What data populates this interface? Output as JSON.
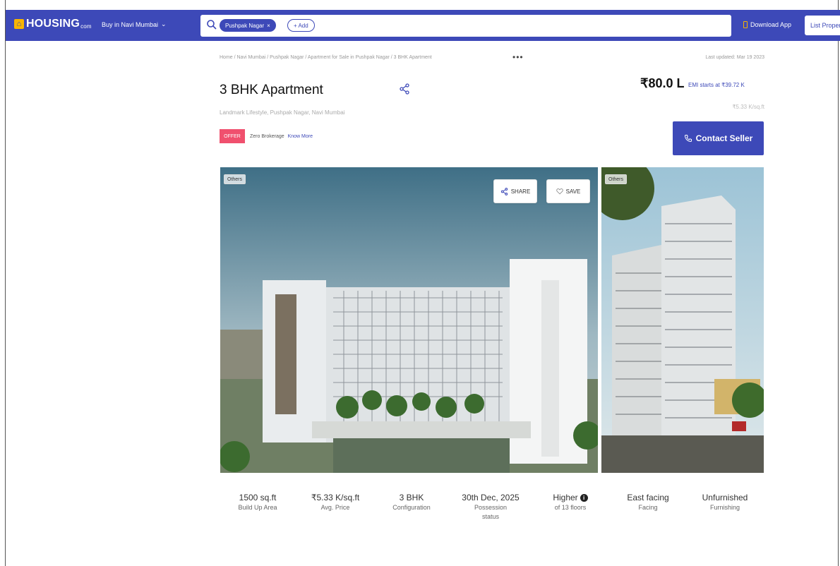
{
  "header": {
    "logo_text": "HOUSING",
    "logo_suffix": "com",
    "city_select": "Buy in Navi Mumbai",
    "search_chip": "Pushpak Nagar",
    "add_chip": "+ Add",
    "download_app": "Download App",
    "list_property": "List Property",
    "brand_color": "#3d49b8",
    "accent_color": "#f7b500"
  },
  "breadcrumb": {
    "text": "Home / Navi Mumbai / Pushpak Nagar / Apartment for Sale in Pushpak Nagar / 3 BHK Apartment",
    "more": "•••",
    "last_updated": "Last updated: Mar 19 2023"
  },
  "listing": {
    "title": "3 BHK Apartment",
    "project": "Landmark Lifestyle, Pushpak Nagar, Navi Mumbai",
    "offer_badge": "OFFER",
    "brokerage_text": "Zero Brokerage",
    "know_more": "Know More",
    "price": "₹80.0 L",
    "emi": "EMI starts at ₹39.72 K",
    "price_per_sqft": "₹5.33 K/sq.ft",
    "contact_button": "Contact Seller",
    "offer_color": "#f0506e"
  },
  "gallery": {
    "main_tag": "Others",
    "side_tag": "Others",
    "share_label": "SHARE",
    "save_label": "SAVE"
  },
  "facts": [
    {
      "value": "1500 sq.ft",
      "label": "Build Up Area"
    },
    {
      "value": "₹5.33 K/sq.ft",
      "label": "Avg. Price"
    },
    {
      "value": "3 BHK",
      "label": "Configuration"
    },
    {
      "value": "30th Dec, 2025",
      "label": "Possession status"
    },
    {
      "value": "Higher",
      "label": "of 13 floors"
    },
    {
      "value": "East facing",
      "label": "Facing"
    },
    {
      "value": "Unfurnished",
      "label": "Furnishing"
    }
  ]
}
